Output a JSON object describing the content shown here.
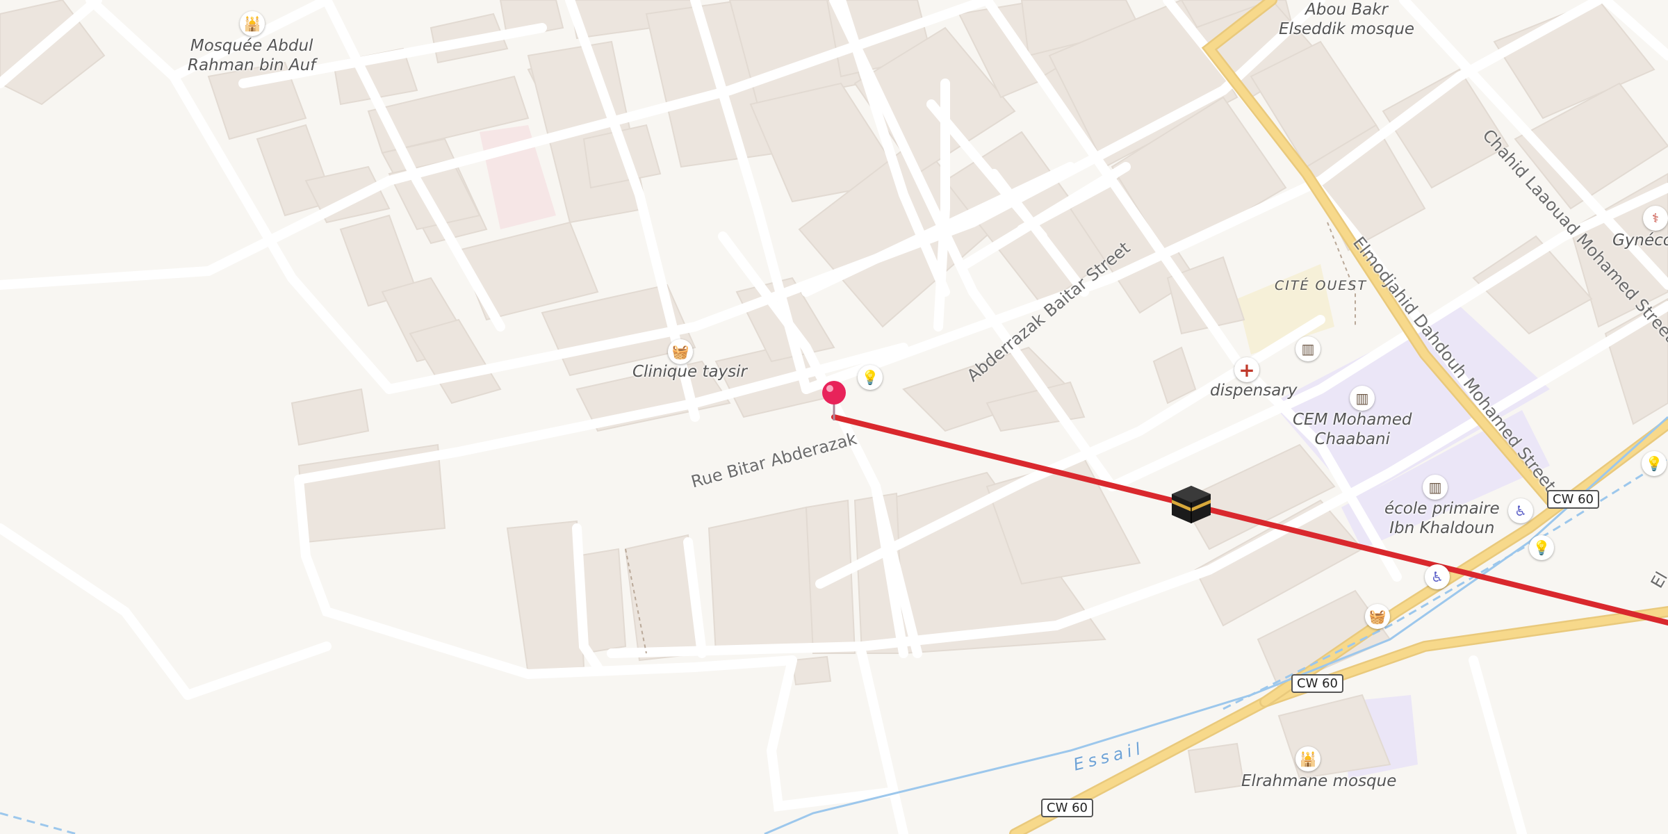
{
  "map": {
    "colors": {
      "background": "#f8f6f2",
      "block": "#ece5de",
      "road": "#ffffff",
      "main_road": "#f7d98b",
      "route_line": "#d9282d",
      "water": "#9cc7ec",
      "school_area": "#ebe6f7"
    },
    "places": [
      {
        "id": "mosque-abdul",
        "label": "Mosquée Abdul\nRahman bin Auf",
        "icon": "mosque-icon"
      },
      {
        "id": "abou-bakr",
        "label": "Abou Bakr\nElseddik mosque",
        "icon": "mosque-icon"
      },
      {
        "id": "clinique",
        "label": "Clinique taysir",
        "icon": "shop-basket-icon"
      },
      {
        "id": "dispensary",
        "label": "dispensary",
        "icon": "medical-cross-icon"
      },
      {
        "id": "cem",
        "label": "CEM Mohamed\nChaabani",
        "icon": "school-icon"
      },
      {
        "id": "ecole",
        "label": "école primaire\nIbn Khaldoun",
        "icon": "school-icon"
      },
      {
        "id": "elrahmane",
        "label": "Elrahmane mosque",
        "icon": "mosque-icon"
      },
      {
        "id": "gynecol",
        "label": "Gynécol",
        "icon": "stethoscope-icon"
      }
    ],
    "district": "CITÉ OUEST",
    "streets": {
      "baitar": "Abderrazak Baitar Street",
      "bitar": "Rue Bitar Abderazak",
      "chahid": "Chahid Laaouad Mohamed Street",
      "elmodjahid": "Elmodjahid Dahdouh Mohamed Street",
      "el": "El"
    },
    "waterway": "Essail",
    "road_shields": [
      "CW 60",
      "CW 60",
      "CW 60"
    ],
    "markers": {
      "pin": "location-pin-icon",
      "destination": "kaaba-icon"
    }
  }
}
